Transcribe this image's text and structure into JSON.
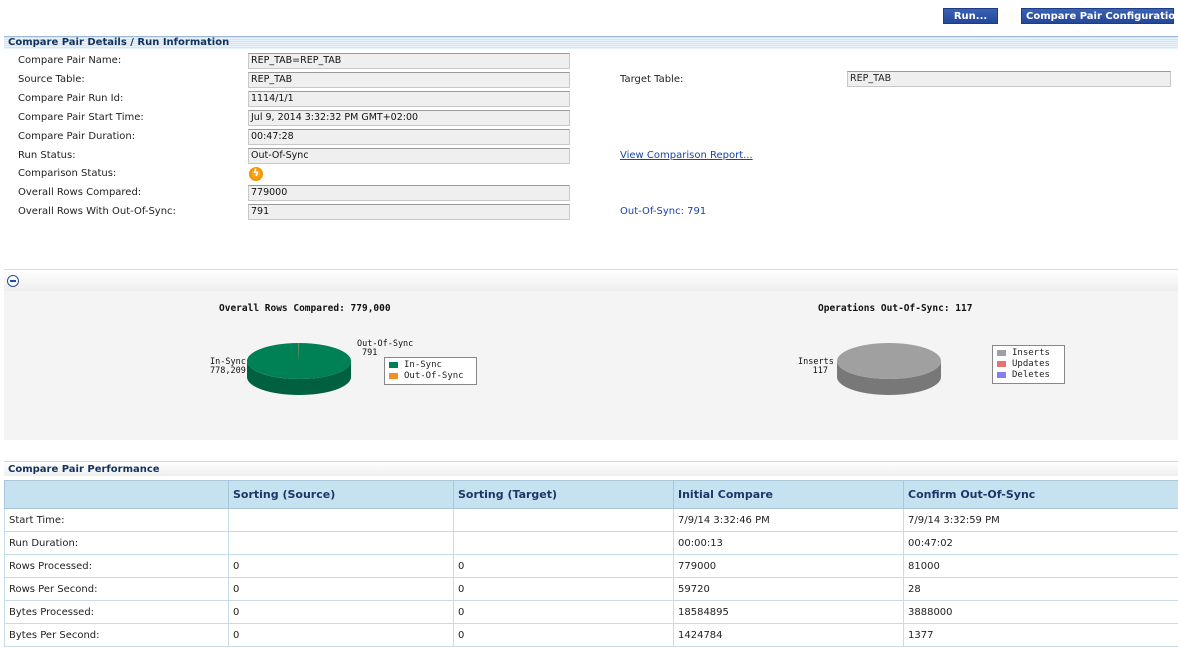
{
  "toolbar": {
    "run_label": "Run...",
    "config_label": "Compare Pair Configuration..."
  },
  "details": {
    "header": "Compare Pair Details / Run Information",
    "name_label": "Compare Pair Name:",
    "name_value": "REP_TAB=REP_TAB",
    "source_label": "Source Table:",
    "source_value": "REP_TAB",
    "target_label": "Target Table:",
    "target_value": "REP_TAB",
    "runid_label": "Compare Pair Run Id:",
    "runid_value": "1114/1/1",
    "start_label": "Compare Pair Start Time:",
    "start_value": "Jul 9, 2014 3:32:32 PM GMT+02:00",
    "duration_label": "Compare Pair Duration:",
    "duration_value": "00:47:28",
    "run_status_label": "Run Status:",
    "run_status_value": "Out-Of-Sync",
    "report_link": "View Comparison Report...",
    "comparison_status_label": "Comparison Status:",
    "comparison_status_icon": "sync-warning-icon",
    "rows_compared_label": "Overall Rows Compared:",
    "rows_compared_value": "779000",
    "rows_oos_label": "Overall Rows With Out-Of-Sync:",
    "rows_oos_value": "791",
    "oos_link": "Out-Of-Sync: 791"
  },
  "chart_data": [
    {
      "type": "pie",
      "title": "Overall Rows Compared: 779,000",
      "categories": [
        "In-Sync",
        "Out-Of-Sync"
      ],
      "values": [
        778209,
        791
      ],
      "labels": [
        [
          "In-Sync",
          "778,209"
        ],
        [
          "Out-Of-Sync",
          "791"
        ]
      ],
      "colors": [
        "#008055",
        "#f39021"
      ],
      "legend": [
        "In-Sync",
        "Out-Of-Sync"
      ],
      "legend_position": "right"
    },
    {
      "type": "pie",
      "title": "Operations Out-Of-Sync: 117",
      "categories": [
        "Inserts",
        "Updates",
        "Deletes"
      ],
      "values": [
        117,
        0,
        0
      ],
      "labels": [
        [
          "Inserts",
          "117"
        ]
      ],
      "colors": [
        "#a0a0a0",
        "#e57373",
        "#8080f0"
      ],
      "legend": [
        "Inserts",
        "Updates",
        "Deletes"
      ],
      "legend_position": "right"
    }
  ],
  "performance": {
    "header": "Compare Pair Performance",
    "columns": [
      "",
      "Sorting (Source)",
      "Sorting (Target)",
      "Initial Compare",
      "Confirm Out-Of-Sync"
    ],
    "rows": [
      [
        "Start Time:",
        "",
        "",
        "7/9/14 3:32:46 PM",
        "7/9/14 3:32:59 PM"
      ],
      [
        "Run Duration:",
        "",
        "",
        "00:00:13",
        "00:47:02"
      ],
      [
        "Rows Processed:",
        "0",
        "0",
        "779000",
        "81000"
      ],
      [
        "Rows Per Second:",
        "0",
        "0",
        "59720",
        "28"
      ],
      [
        "Bytes Processed:",
        "0",
        "0",
        "18584895",
        "3888000"
      ],
      [
        "Bytes Per Second:",
        "0",
        "0",
        "1424784",
        "1377"
      ]
    ]
  }
}
